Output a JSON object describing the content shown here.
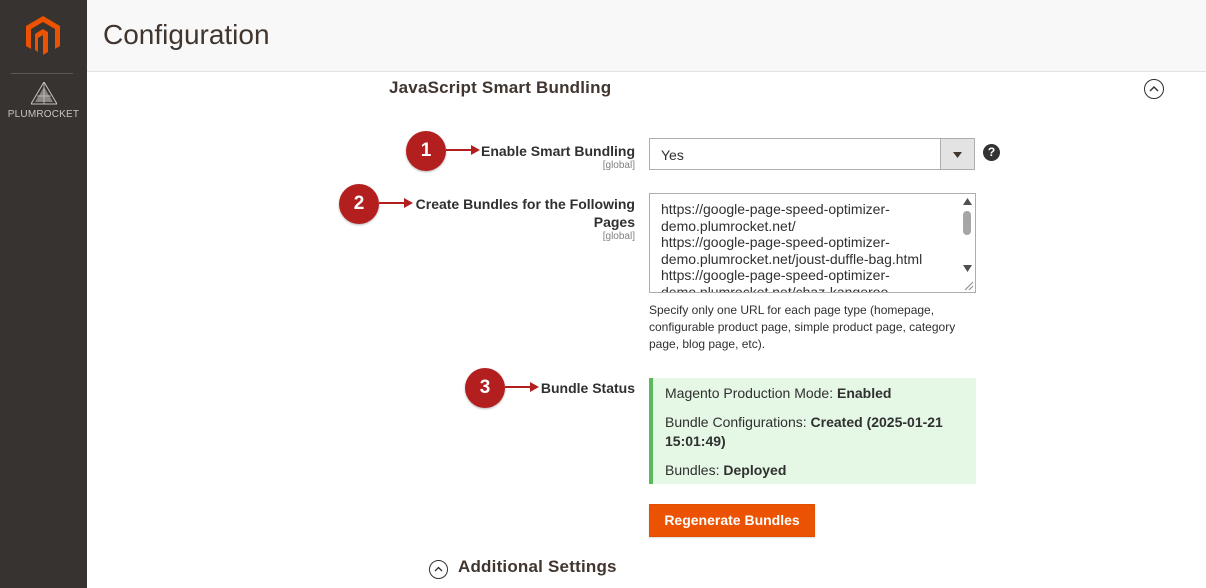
{
  "sidebar": {
    "brand_logo": "magento-logo-icon",
    "partner_logo": "plumrocket-logo-icon",
    "partner_name": "PLUMROCKET"
  },
  "header": {
    "title": "Configuration"
  },
  "section": {
    "title": "JavaScript Smart Bundling",
    "collapse_icon": "chevron-up-circle-icon"
  },
  "fields": {
    "enable": {
      "marker": "1",
      "label": "Enable Smart Bundling",
      "scope": "[global]",
      "value": "Yes",
      "help_icon": "?"
    },
    "pages": {
      "marker": "2",
      "label_line1": "Create Bundles for the Following",
      "label_line2": "Pages",
      "scope": "[global]",
      "value": "https://google-page-speed-optimizer-\ndemo.plumrocket.net/\nhttps://google-page-speed-optimizer-\ndemo.plumrocket.net/joust-duffle-bag.html\nhttps://google-page-speed-optimizer-\ndemo.plumrocket.net/chaz-kangeroo-",
      "note": "Specify only one URL for each page type (homepage, configurable product page, simple product page, category page, blog page, etc)."
    },
    "status": {
      "marker": "3",
      "label": "Bundle Status",
      "mode_label": "Magento Production Mode: ",
      "mode_value": "Enabled",
      "config_label": "Bundle Configurations: ",
      "config_value_line1": "Created (2025-01-21",
      "config_value_line2": "15:01:49)",
      "bundles_label": "Bundles: ",
      "bundles_value": "Deployed"
    }
  },
  "actions": {
    "regenerate_label": "Regenerate Bundles"
  },
  "additional": {
    "label": "Additional Settings"
  },
  "colors": {
    "sidebar_bg": "#373330",
    "accent": "#eb5202",
    "marker": "#b31f1f",
    "success_bg": "#e5f7e5",
    "success_border": "#5cb85c"
  }
}
